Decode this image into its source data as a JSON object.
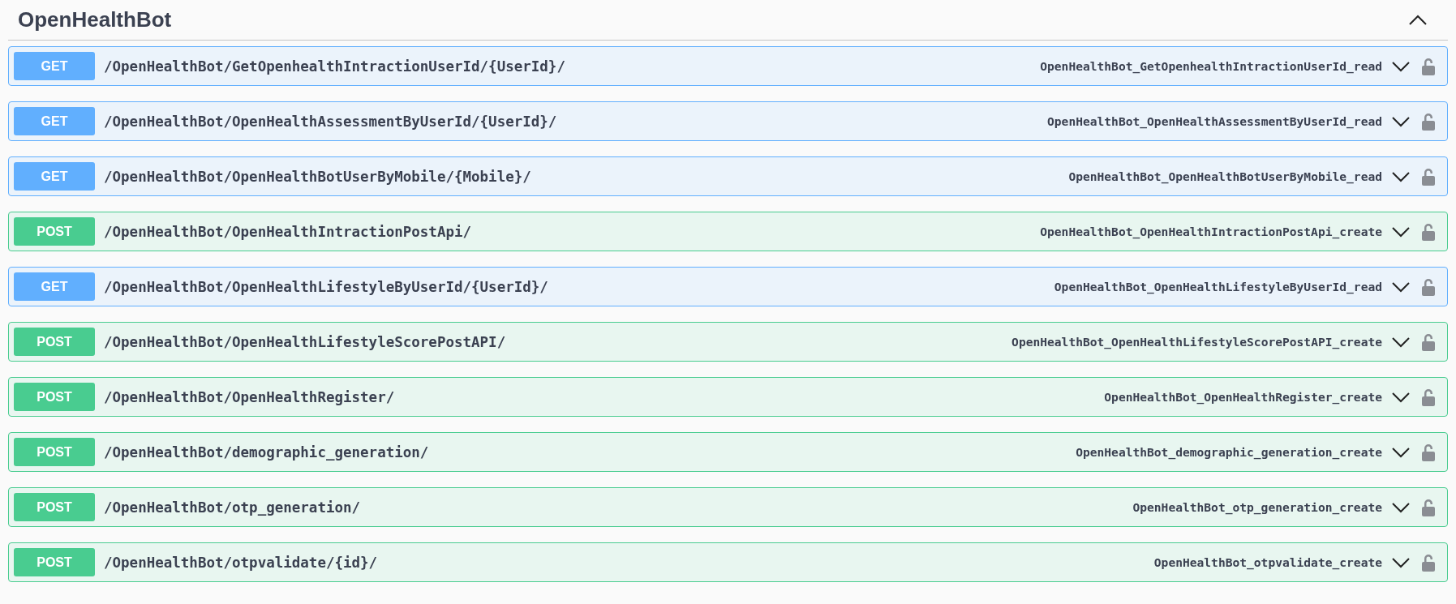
{
  "tag": {
    "title": "OpenHealthBot",
    "expanded": true
  },
  "operations": [
    {
      "method": "GET",
      "path": "/OpenHealthBot/GetOpenhealthIntractionUserId/{UserId}/",
      "operation_id": "OpenHealthBot_GetOpenhealthIntractionUserId_read"
    },
    {
      "method": "GET",
      "path": "/OpenHealthBot/OpenHealthAssessmentByUserId/{UserId}/",
      "operation_id": "OpenHealthBot_OpenHealthAssessmentByUserId_read"
    },
    {
      "method": "GET",
      "path": "/OpenHealthBot/OpenHealthBotUserByMobile/{Mobile}/",
      "operation_id": "OpenHealthBot_OpenHealthBotUserByMobile_read"
    },
    {
      "method": "POST",
      "path": "/OpenHealthBot/OpenHealthIntractionPostApi/",
      "operation_id": "OpenHealthBot_OpenHealthIntractionPostApi_create"
    },
    {
      "method": "GET",
      "path": "/OpenHealthBot/OpenHealthLifestyleByUserId/{UserId}/",
      "operation_id": "OpenHealthBot_OpenHealthLifestyleByUserId_read"
    },
    {
      "method": "POST",
      "path": "/OpenHealthBot/OpenHealthLifestyleScorePostAPI/",
      "operation_id": "OpenHealthBot_OpenHealthLifestyleScorePostAPI_create"
    },
    {
      "method": "POST",
      "path": "/OpenHealthBot/OpenHealthRegister/",
      "operation_id": "OpenHealthBot_OpenHealthRegister_create"
    },
    {
      "method": "POST",
      "path": "/OpenHealthBot/demographic_generation/",
      "operation_id": "OpenHealthBot_demographic_generation_create"
    },
    {
      "method": "POST",
      "path": "/OpenHealthBot/otp_generation/",
      "operation_id": "OpenHealthBot_otp_generation_create"
    },
    {
      "method": "POST",
      "path": "/OpenHealthBot/otpvalidate/{id}/",
      "operation_id": "OpenHealthBot_otpvalidate_create"
    }
  ]
}
